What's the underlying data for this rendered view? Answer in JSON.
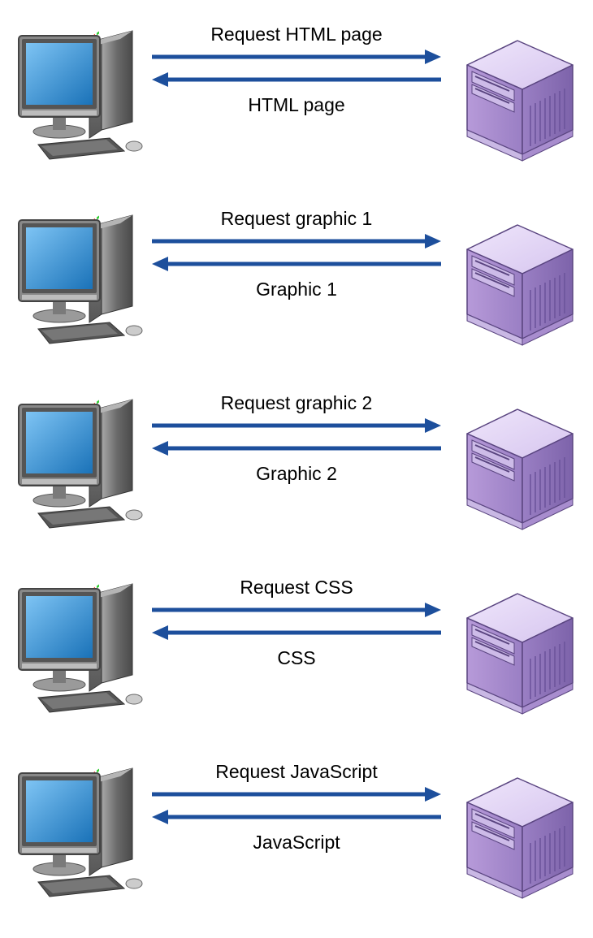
{
  "rows": [
    {
      "request": "Request HTML page",
      "response": "HTML page"
    },
    {
      "request": "Request graphic 1",
      "response": "Graphic 1"
    },
    {
      "request": "Request graphic 2",
      "response": "Graphic 2"
    },
    {
      "request": "Request CSS",
      "response": "CSS"
    },
    {
      "request": "Request JavaScript",
      "response": "JavaScript"
    }
  ],
  "colors": {
    "arrow": "#1d4f9c",
    "monitorLight": "#7ec4f4",
    "monitorDark": "#1a72b8",
    "towerBody": "#6e6e6e",
    "serverLight": "#d6c5ef",
    "serverMid": "#b79ad9",
    "serverDark": "#9a7fc4"
  }
}
